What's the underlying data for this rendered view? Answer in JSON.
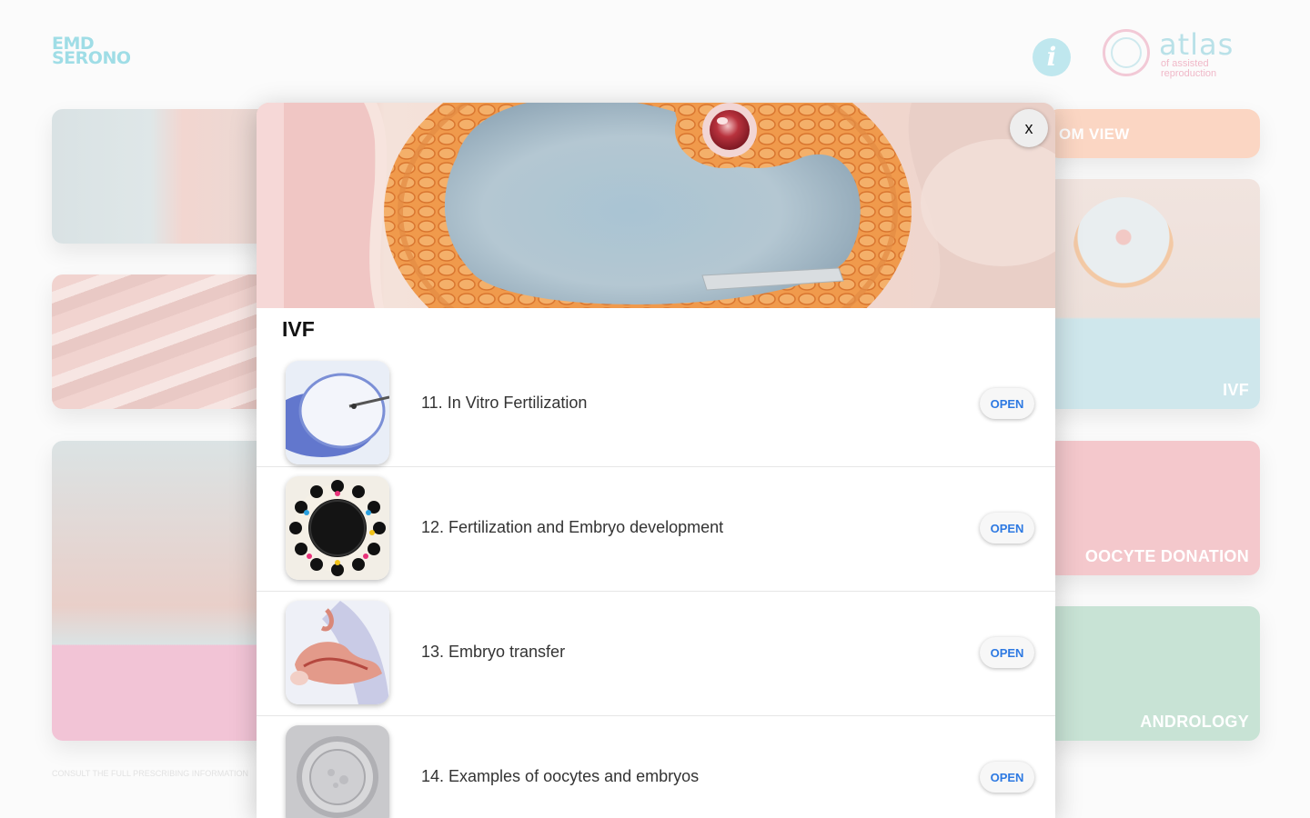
{
  "background": {
    "logo_left": "EMD SERONO",
    "logo_right_word": "atlas",
    "logo_right_sub": "of assisted reproduction",
    "info_icon": "i",
    "cards": {
      "zoom_view": "OM VIEW",
      "ivf": "IVF",
      "oocyte_donation": "OOCYTE DONATION",
      "andrology": "ANDROLOGY"
    },
    "footer": "CONSULT THE FULL PRESCRIBING INFORMATION"
  },
  "modal": {
    "close_label": "x",
    "title": "IVF",
    "items": [
      {
        "label": "11. In Vitro Fertilization",
        "button": "OPEN",
        "thumb_icon": "ivf-needle-oocyte-icon"
      },
      {
        "label": "12. Fertilization and Embryo development",
        "button": "OPEN",
        "thumb_icon": "zygote-circle-icon"
      },
      {
        "label": "13. Embryo transfer",
        "button": "OPEN",
        "thumb_icon": "uterus-catheter-icon"
      },
      {
        "label": "14. Examples of oocytes and embryos",
        "button": "OPEN",
        "thumb_icon": "microscope-oocyte-icon"
      }
    ]
  },
  "colors": {
    "accent_blue": "#2d79e2",
    "logo_teal": "#9fdde6",
    "logo_pink": "#f0b8c8"
  }
}
